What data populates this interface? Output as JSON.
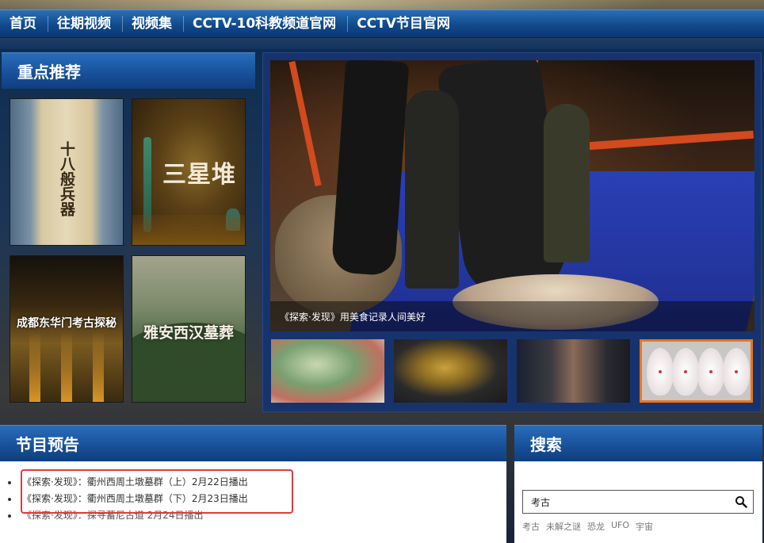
{
  "nav": {
    "items": [
      "首页",
      "往期视频",
      "视频集",
      "CCTV-10科教频道官网",
      "CCTV节目官网"
    ]
  },
  "featured": {
    "title": "重点推荐",
    "items": [
      {
        "caption": "十八般兵器"
      },
      {
        "caption": "三星堆"
      },
      {
        "caption": "成都东华门考古探秘"
      },
      {
        "caption": "雅安西汉墓葬"
      }
    ]
  },
  "slideshow": {
    "caption": "《探索·发现》用美食记录人间美好",
    "active_thumb": 4
  },
  "preview": {
    "title": "节目预告",
    "items": [
      "《探索·发现》：衢州西周土墩墓群（上）2月22日播出",
      "《探索·发现》：衢州西周土墩墓群（下）2月23日播出",
      "《探索·发现》：探寻蓄尼古道 2月24日播出"
    ]
  },
  "search": {
    "title": "搜索",
    "value": "考古",
    "button_icon": "search-icon",
    "hot_tags": [
      "考古",
      "未解之谜",
      "恐龙",
      "UFO",
      "宇宙"
    ]
  },
  "colors": {
    "header_blue": "#174f98",
    "highlight_red": "#e03a3a",
    "active_thumb_border": "#e8761e"
  }
}
